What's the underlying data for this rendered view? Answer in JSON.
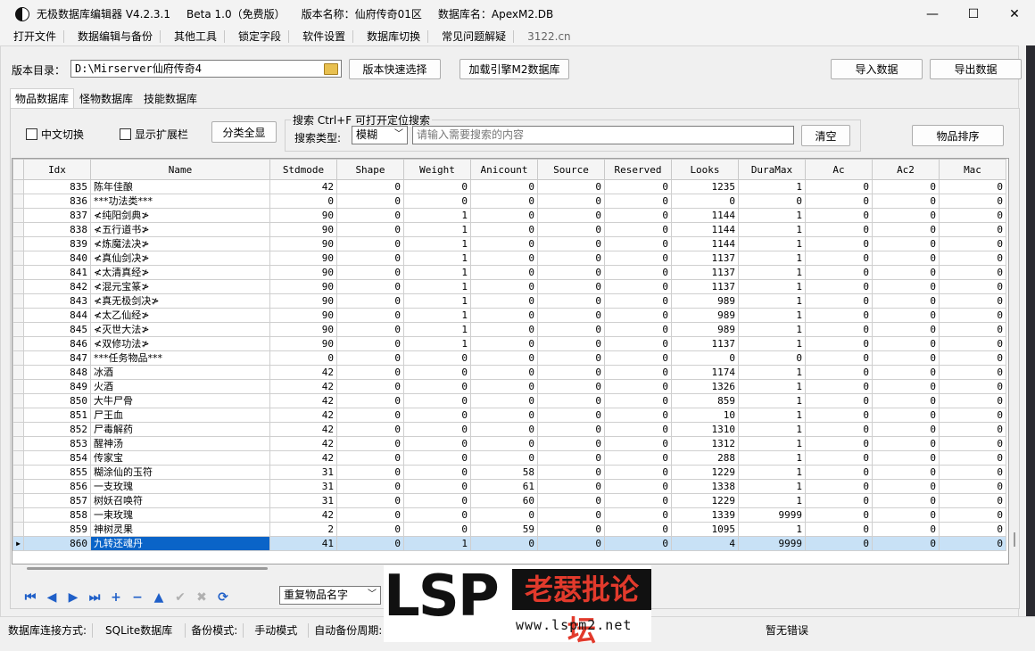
{
  "window": {
    "title": "无极数据库编辑器 V4.2.3.1",
    "edition": "Beta 1.0（免费版）",
    "version_name": "版本名称：仙府传奇01区",
    "db_name": "数据库名：ApexM2.DB",
    "minimize_glyph": "—",
    "maximize_glyph": "☐",
    "close_glyph": "✕"
  },
  "menu": [
    "打开文件",
    "数据编辑与备份",
    "其他工具",
    "锁定字段",
    "软件设置",
    "数据库切换",
    "常见问题解疑",
    "3122.cn"
  ],
  "toolbar": {
    "dir_label": "版本目录：",
    "dir_value": "D:\\Mirserver仙府传奇4",
    "quick_select": "版本快速选择",
    "load_engine": "加载引擎M2数据库",
    "import": "导入数据",
    "export": "导出数据"
  },
  "tabs": [
    "物品数据库",
    "怪物数据库",
    "技能数据库"
  ],
  "filters": {
    "chinese_toggle": "中文切换",
    "show_extension": "显示扩展栏",
    "expand_all": "分类全显",
    "search_legend": "搜索  Ctrl+F 可打开定位搜索",
    "search_type_label": "搜索类型:",
    "search_type_value": "模糊",
    "search_placeholder": "请输入需要搜索的内容",
    "clear": "清空",
    "sort": "物品排序"
  },
  "grid": {
    "columns": [
      "Idx",
      "Name",
      "Stdmode",
      "Shape",
      "Weight",
      "Anicount",
      "Source",
      "Reserved",
      "Looks",
      "DuraMax",
      "Ac",
      "Ac2",
      "Mac"
    ],
    "selected_index": 25,
    "rows": [
      [
        "835",
        "陈年佳酿",
        "42",
        "0",
        "0",
        "0",
        "0",
        "0",
        "1235",
        "1",
        "0",
        "0",
        "0"
      ],
      [
        "836",
        "***功法类***",
        "0",
        "0",
        "0",
        "0",
        "0",
        "0",
        "0",
        "0",
        "0",
        "0",
        "0"
      ],
      [
        "837",
        "≮纯阳剑典≯",
        "90",
        "0",
        "1",
        "0",
        "0",
        "0",
        "1144",
        "1",
        "0",
        "0",
        "0"
      ],
      [
        "838",
        "≮五行道书≯",
        "90",
        "0",
        "1",
        "0",
        "0",
        "0",
        "1144",
        "1",
        "0",
        "0",
        "0"
      ],
      [
        "839",
        "≮炼魔法决≯",
        "90",
        "0",
        "1",
        "0",
        "0",
        "0",
        "1144",
        "1",
        "0",
        "0",
        "0"
      ],
      [
        "840",
        "≮真仙剑决≯",
        "90",
        "0",
        "1",
        "0",
        "0",
        "0",
        "1137",
        "1",
        "0",
        "0",
        "0"
      ],
      [
        "841",
        "≮太清真经≯",
        "90",
        "0",
        "1",
        "0",
        "0",
        "0",
        "1137",
        "1",
        "0",
        "0",
        "0"
      ],
      [
        "842",
        "≮混元宝篆≯",
        "90",
        "0",
        "1",
        "0",
        "0",
        "0",
        "1137",
        "1",
        "0",
        "0",
        "0"
      ],
      [
        "843",
        "≮真无极剑决≯",
        "90",
        "0",
        "1",
        "0",
        "0",
        "0",
        "989",
        "1",
        "0",
        "0",
        "0"
      ],
      [
        "844",
        "≮太乙仙经≯",
        "90",
        "0",
        "1",
        "0",
        "0",
        "0",
        "989",
        "1",
        "0",
        "0",
        "0"
      ],
      [
        "845",
        "≮灭世大法≯",
        "90",
        "0",
        "1",
        "0",
        "0",
        "0",
        "989",
        "1",
        "0",
        "0",
        "0"
      ],
      [
        "846",
        "≮双修功法≯",
        "90",
        "0",
        "1",
        "0",
        "0",
        "0",
        "1137",
        "1",
        "0",
        "0",
        "0"
      ],
      [
        "847",
        "***任务物品***",
        "0",
        "0",
        "0",
        "0",
        "0",
        "0",
        "0",
        "0",
        "0",
        "0",
        "0"
      ],
      [
        "848",
        "冰酒",
        "42",
        "0",
        "0",
        "0",
        "0",
        "0",
        "1174",
        "1",
        "0",
        "0",
        "0"
      ],
      [
        "849",
        "火酒",
        "42",
        "0",
        "0",
        "0",
        "0",
        "0",
        "1326",
        "1",
        "0",
        "0",
        "0"
      ],
      [
        "850",
        "大牛尸骨",
        "42",
        "0",
        "0",
        "0",
        "0",
        "0",
        "859",
        "1",
        "0",
        "0",
        "0"
      ],
      [
        "851",
        "尸王血",
        "42",
        "0",
        "0",
        "0",
        "0",
        "0",
        "10",
        "1",
        "0",
        "0",
        "0"
      ],
      [
        "852",
        "尸毒解药",
        "42",
        "0",
        "0",
        "0",
        "0",
        "0",
        "1310",
        "1",
        "0",
        "0",
        "0"
      ],
      [
        "853",
        "醒神汤",
        "42",
        "0",
        "0",
        "0",
        "0",
        "0",
        "1312",
        "1",
        "0",
        "0",
        "0"
      ],
      [
        "854",
        "传家宝",
        "42",
        "0",
        "0",
        "0",
        "0",
        "0",
        "288",
        "1",
        "0",
        "0",
        "0"
      ],
      [
        "855",
        "糊涂仙的玉符",
        "31",
        "0",
        "0",
        "58",
        "0",
        "0",
        "1229",
        "1",
        "0",
        "0",
        "0"
      ],
      [
        "856",
        "一支玫瑰",
        "31",
        "0",
        "0",
        "61",
        "0",
        "0",
        "1338",
        "1",
        "0",
        "0",
        "0"
      ],
      [
        "857",
        "树妖召唤符",
        "31",
        "0",
        "0",
        "60",
        "0",
        "0",
        "1229",
        "1",
        "0",
        "0",
        "0"
      ],
      [
        "858",
        "一束玫瑰",
        "42",
        "0",
        "0",
        "0",
        "0",
        "0",
        "1339",
        "9999",
        "0",
        "0",
        "0"
      ],
      [
        "859",
        "神树灵果",
        "2",
        "0",
        "0",
        "59",
        "0",
        "0",
        "1095",
        "1",
        "0",
        "0",
        "0"
      ],
      [
        "860",
        "九转还魂丹",
        "41",
        "0",
        "1",
        "0",
        "0",
        "0",
        "4",
        "9999",
        "0",
        "0",
        "0"
      ]
    ]
  },
  "navigator": {
    "buttons": [
      {
        "name": "first-record-icon",
        "glyph": "⏮",
        "enabled": true
      },
      {
        "name": "prior-record-icon",
        "glyph": "◀",
        "enabled": true
      },
      {
        "name": "next-record-icon",
        "glyph": "▶",
        "enabled": true
      },
      {
        "name": "last-record-icon",
        "glyph": "⏭",
        "enabled": true
      },
      {
        "name": "insert-record-icon",
        "glyph": "+",
        "enabled": true
      },
      {
        "name": "delete-record-icon",
        "glyph": "−",
        "enabled": true
      },
      {
        "name": "edit-record-icon",
        "glyph": "▲",
        "enabled": true
      },
      {
        "name": "post-record-icon",
        "glyph": "✔",
        "enabled": false
      },
      {
        "name": "cancel-record-icon",
        "glyph": "✖",
        "enabled": false
      },
      {
        "name": "refresh-record-icon",
        "glyph": "⟳",
        "enabled": true
      }
    ],
    "duplicate_select": "重复物品名字"
  },
  "status": {
    "conn_label": "数据库连接方式:",
    "conn_value": "SQLite数据库",
    "backup_label": "备份模式:",
    "backup_value": "手动模式",
    "auto_backup": "自动备份周期:",
    "error": "暂无错误"
  },
  "watermark": {
    "brand": "LSP",
    "cn": "老瑟批论坛",
    "url": "www.lspm2.net"
  },
  "colors": {
    "selection": "#0a64c8",
    "selection_row": "#c8e1f6",
    "nav_blue": "#1f5fc8",
    "watermark_red": "#e23a2c"
  }
}
